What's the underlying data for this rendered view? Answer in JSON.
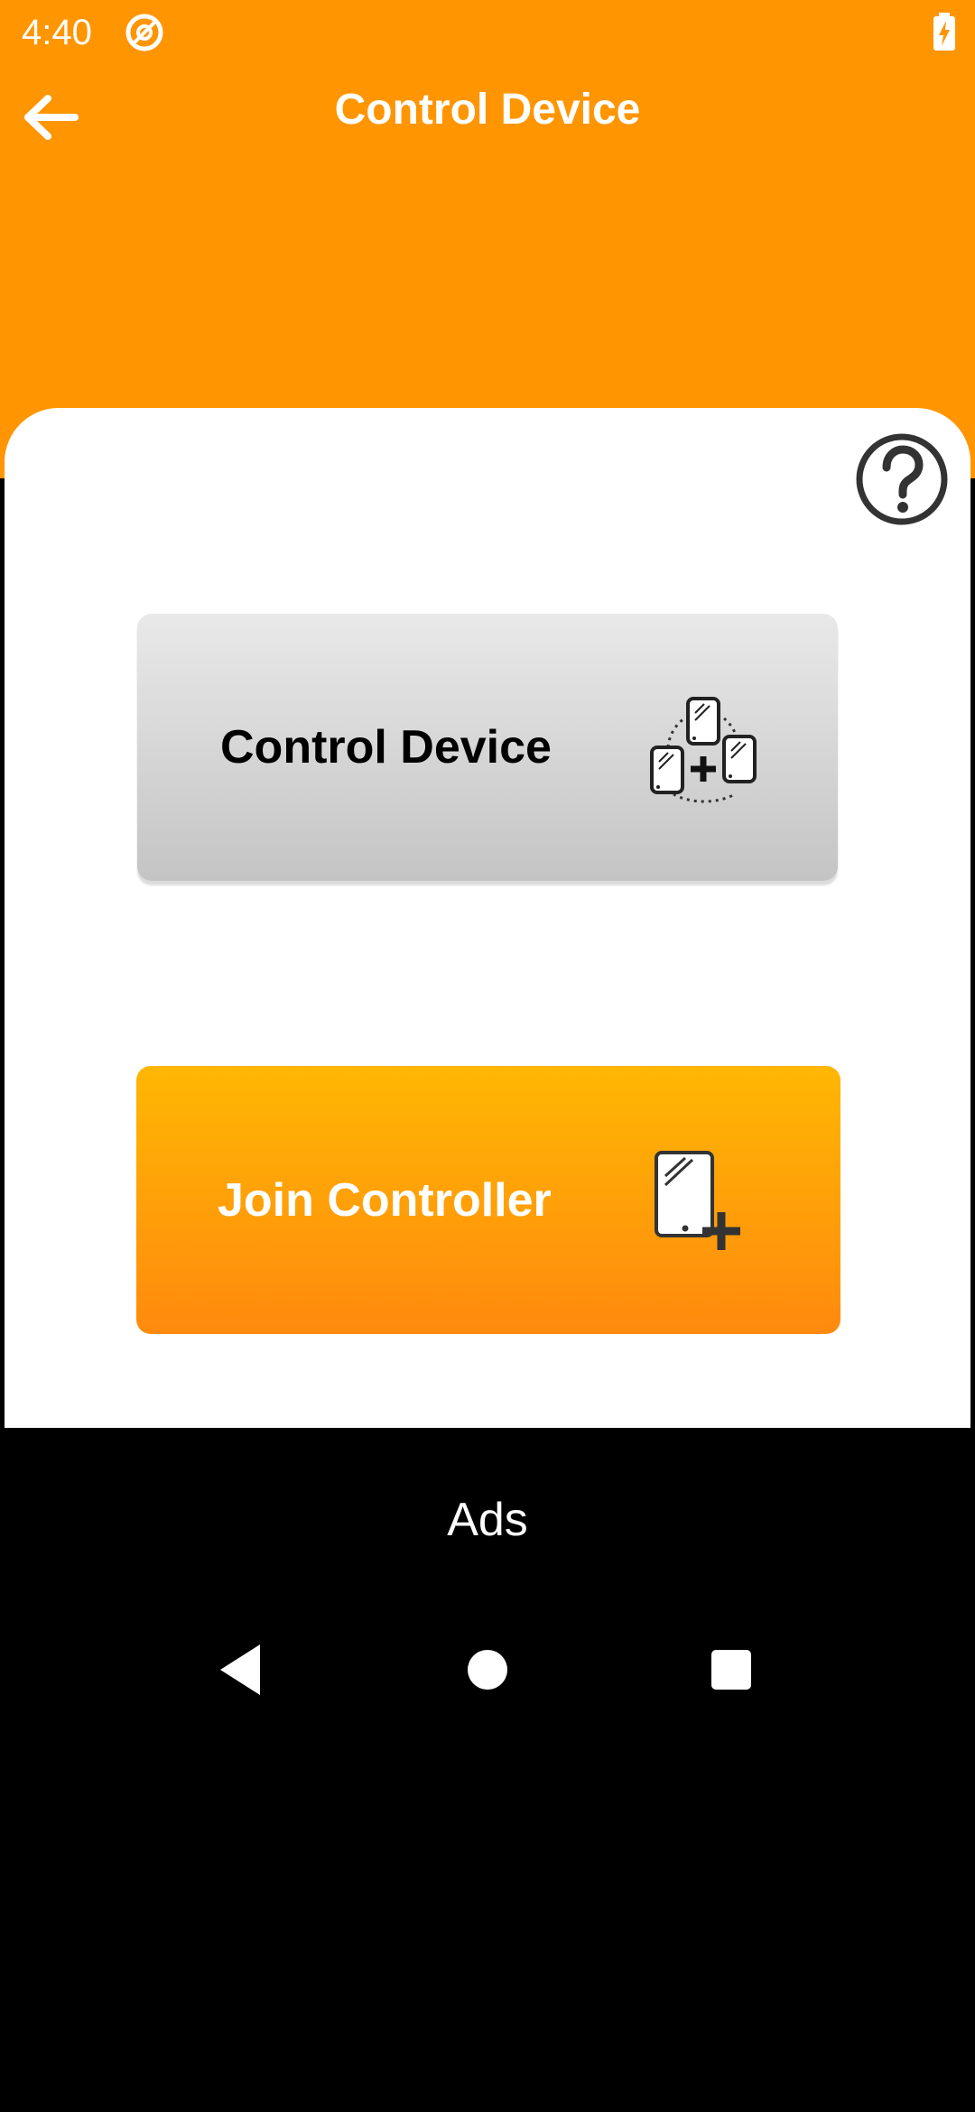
{
  "status_bar": {
    "time": "4:40",
    "notification_icon": "at-sign-icon",
    "battery_icon": "battery-charging-icon"
  },
  "app_bar": {
    "title": "Control Device",
    "back_icon": "arrow-left-icon"
  },
  "help": {
    "icon": "question-circle-icon"
  },
  "buttons": {
    "control_device": {
      "label": "Control Device",
      "icon": "devices-connect-icon"
    },
    "join_controller": {
      "label": "Join Controller",
      "icon": "device-add-icon"
    }
  },
  "ads": {
    "label": "Ads"
  },
  "nav": {
    "back_icon": "nav-back-icon",
    "home_icon": "nav-home-icon",
    "recents_icon": "nav-recents-icon"
  },
  "colors": {
    "primary": "#FF9500",
    "join_gradient_top": "#FFB703",
    "join_gradient_bottom": "#FF8A0E",
    "control_gradient_top": "#E9E9E9",
    "control_gradient_bottom": "#C4C4C4"
  }
}
